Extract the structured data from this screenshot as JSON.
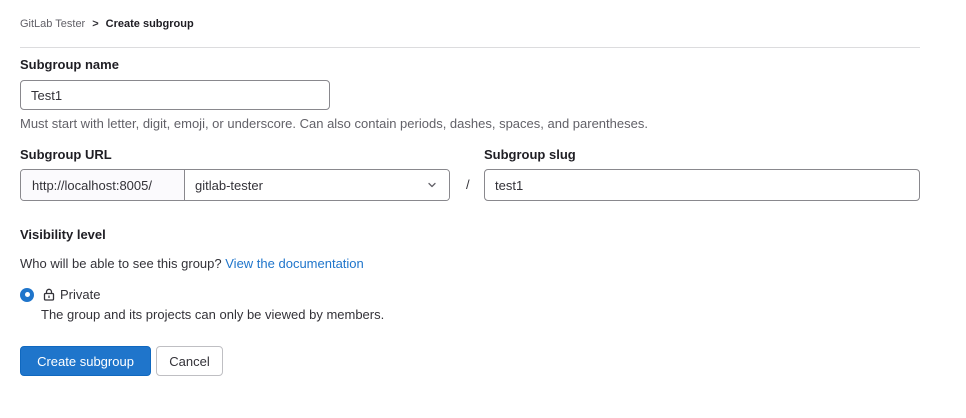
{
  "breadcrumb": {
    "parent": "GitLab Tester",
    "separator": ">",
    "current": "Create subgroup"
  },
  "form": {
    "name_label": "Subgroup name",
    "name_value": "Test1",
    "name_help": "Must start with letter, digit, emoji, or underscore. Can also contain periods, dashes, spaces, and parentheses.",
    "url_label": "Subgroup URL",
    "url_prefix": "http://localhost:8005/",
    "url_parent_selected": "gitlab-tester",
    "slash": "/",
    "slug_label": "Subgroup slug",
    "slug_value": "test1",
    "visibility_label": "Visibility level",
    "visibility_question": "Who will be able to see this group?",
    "visibility_doc_link": "View the documentation",
    "visibility_option_label": "Private",
    "visibility_option_desc": "The group and its projects can only be viewed by members."
  },
  "actions": {
    "create_label": "Create subgroup",
    "cancel_label": "Cancel"
  },
  "colors": {
    "accent": "#1f75cb",
    "text": "#333238",
    "muted": "#626168",
    "border": "#89888d"
  },
  "icons": {
    "chevron": "chevron-down-icon",
    "lock": "lock-icon"
  }
}
